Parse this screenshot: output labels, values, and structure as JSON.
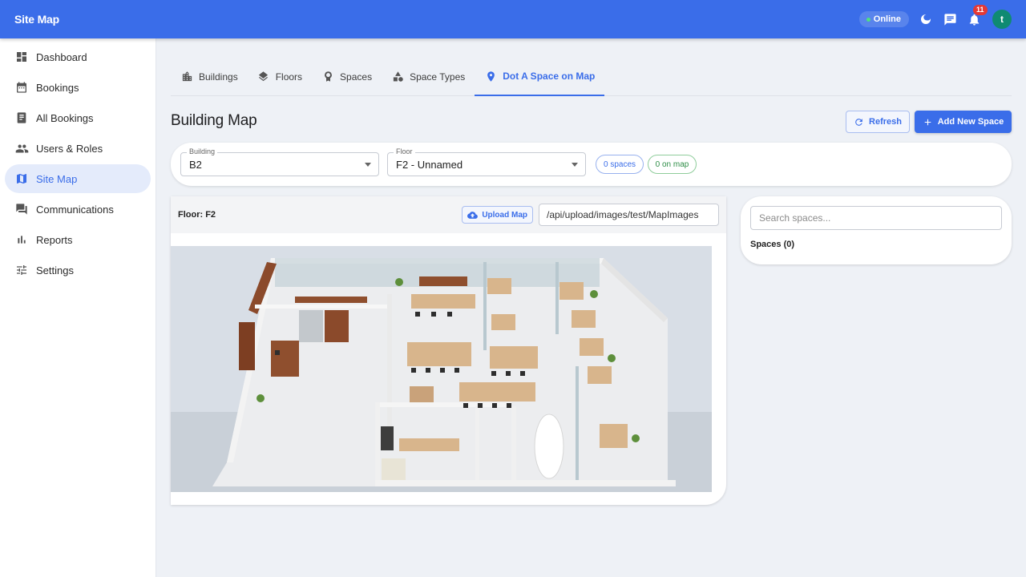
{
  "app": {
    "title": "Site Map"
  },
  "topbar": {
    "status": "Online",
    "notifications_count": "11",
    "avatar_letter": "t"
  },
  "sidebar": {
    "items": [
      {
        "label": "Dashboard",
        "icon": "dashboard-icon"
      },
      {
        "label": "Bookings",
        "icon": "calendar-icon"
      },
      {
        "label": "All Bookings",
        "icon": "book-icon"
      },
      {
        "label": "Users & Roles",
        "icon": "people-icon"
      },
      {
        "label": "Site Map",
        "icon": "map-icon",
        "active": true
      },
      {
        "label": "Communications",
        "icon": "forum-icon"
      },
      {
        "label": "Reports",
        "icon": "bar-chart-icon"
      },
      {
        "label": "Settings",
        "icon": "sliders-icon"
      }
    ]
  },
  "tabs": [
    {
      "label": "Buildings",
      "icon": "building-icon"
    },
    {
      "label": "Floors",
      "icon": "layers-icon"
    },
    {
      "label": "Spaces",
      "icon": "badge-icon"
    },
    {
      "label": "Space Types",
      "icon": "shapes-icon"
    },
    {
      "label": "Dot A Space on Map",
      "icon": "pin-icon",
      "active": true
    }
  ],
  "page": {
    "title": "Building Map",
    "refresh_label": "Refresh",
    "add_label": "Add New Space"
  },
  "filters": {
    "building_label": "Building",
    "building_value": "B2",
    "floor_label": "Floor",
    "floor_value": "F2 - Unnamed",
    "spaces_chip": "0 spaces",
    "on_map_chip": "0 on map"
  },
  "map": {
    "floor_label": "Floor: F2",
    "upload_label": "Upload Map",
    "image_url": "/api/upload/images/test/MapImages"
  },
  "spaces_panel": {
    "search_placeholder": "Search spaces...",
    "count_label": "Spaces (0)"
  },
  "colors": {
    "primary": "#3a6de9",
    "online_dot": "#4ee07f",
    "badge": "#e53935",
    "avatar": "#0f8a72",
    "chip_green": "#2f8e48"
  }
}
